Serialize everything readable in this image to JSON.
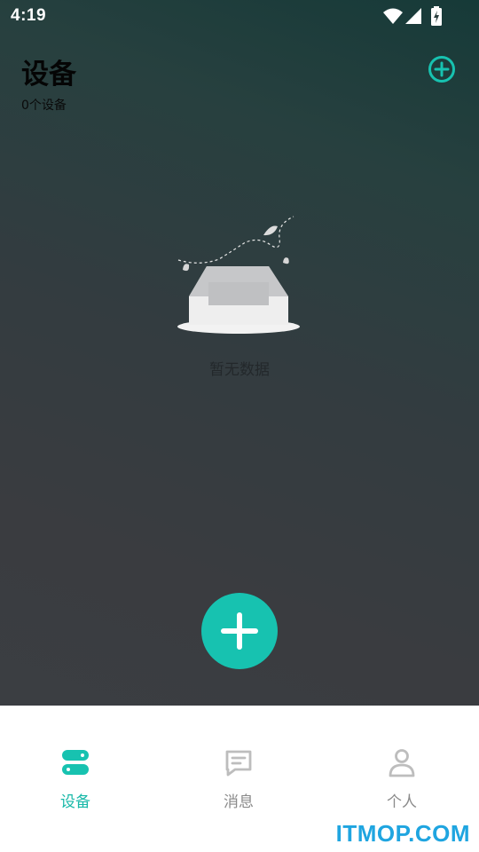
{
  "status_bar": {
    "time": "4:19",
    "icons": [
      "wifi-icon",
      "signal-icon",
      "battery-charging-icon"
    ]
  },
  "header": {
    "title": "设备",
    "subtitle": "0个设备",
    "add_icon": "plus-circle-icon"
  },
  "empty_state": {
    "illustration": "empty-inbox-illustration",
    "text": "暂无数据"
  },
  "fab": {
    "icon": "plus-icon"
  },
  "tabbar": {
    "active": 0,
    "items": [
      {
        "label": "设备",
        "icon": "device-icon"
      },
      {
        "label": "消息",
        "icon": "message-icon"
      },
      {
        "label": "个人",
        "icon": "person-icon"
      }
    ]
  },
  "watermark": "ITMOP.COM",
  "colors": {
    "accent": "#17c2b0",
    "inactive": "#8a8a8a",
    "watermark": "#1fa5e0"
  }
}
